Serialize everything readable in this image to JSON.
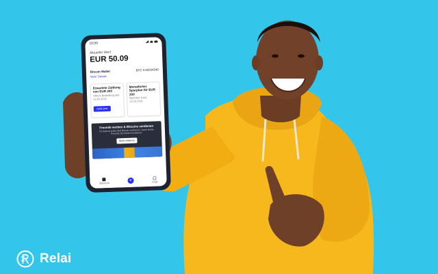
{
  "phone": {
    "status_time": "10:00",
    "value_label": "Aktueller Wert",
    "value_amount": "EUR 50.09",
    "wallet_label": "Bitcoin Wallet",
    "wallet_amount": "BTC 0.00254340",
    "details_link": "Mehr Details",
    "cards": [
      {
        "title": "Erwartete Zahlung von EUR 200",
        "subtitle": "Offene Bestellung seit 23.09.2021",
        "button": "Zahle jetzt"
      },
      {
        "title": "Monatlicher Sparplan für EUR 200",
        "subtitle": "Nächster Kauf 23.10.2021"
      }
    ],
    "banner": {
      "title": "Freunde werben & Bitcoins verdienen",
      "text": "Du kannst jedes Mal Bitcoin verdienen, wenn deine Freunde bei Relai investieren.",
      "button": "Mehr erfahren"
    },
    "tabs": [
      {
        "label": "Übersicht",
        "icon": "grid-icon"
      },
      {
        "label": "",
        "icon": "plus-icon"
      },
      {
        "label": "Profil",
        "icon": "profile-icon"
      }
    ]
  },
  "brand": {
    "name": "Relai",
    "icon": "relai-logo-icon"
  },
  "colors": {
    "background": "#33c6ea",
    "hoodie": "#f6b81c",
    "accent": "#2b2ff2",
    "phone_frame": "#1d2230"
  }
}
